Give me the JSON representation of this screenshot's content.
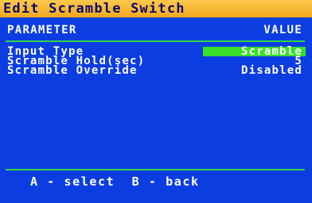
{
  "window": {
    "title": "Edit Scramble Switch"
  },
  "table": {
    "header_param": "PARAMETER",
    "header_value": "VALUE",
    "rows": [
      {
        "label": "Input Type",
        "value": "Scramble",
        "selected": true
      },
      {
        "label": "Scramble Hold(sec)",
        "value": "5",
        "selected": false
      },
      {
        "label": "Scramble Override",
        "value": "Disabled",
        "selected": false
      }
    ]
  },
  "footer": {
    "hint": "A - select  B - back"
  },
  "colors": {
    "title_bar": "#f0a81c",
    "title_text": "#0a0a6e",
    "panel": "#0b3de0",
    "rule": "#2fd64a",
    "selection": "#38e02a",
    "text": "#ffffff"
  }
}
